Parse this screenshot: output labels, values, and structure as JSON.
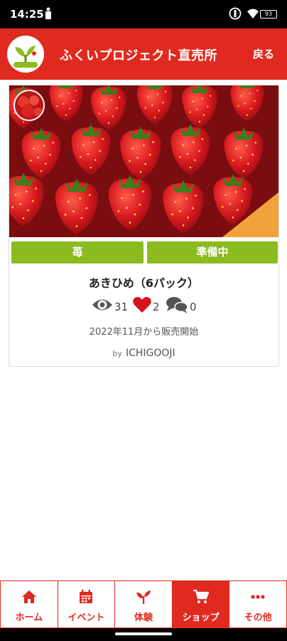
{
  "status_bar": {
    "time": "14:25",
    "battery": "93",
    "icons": [
      "silent-icon",
      "wifi-icon",
      "battery-icon"
    ]
  },
  "header": {
    "title": "ふくいプロジェクト直売所",
    "back_label": "戻る",
    "logo_icon": "sprout-logo-icon"
  },
  "product": {
    "category": "苺",
    "status": "準備中",
    "name": "あきひめ（6パック）",
    "views": "31",
    "likes": "2",
    "comments": "0",
    "release": "2022年11月から販売開始",
    "by_label": "by",
    "author": "ICHIGOOJI"
  },
  "nav": {
    "items": [
      {
        "label": "ホーム",
        "icon": "home-icon"
      },
      {
        "label": "イベント",
        "icon": "calendar-icon"
      },
      {
        "label": "体験",
        "icon": "sprout-icon"
      },
      {
        "label": "ショップ",
        "icon": "cart-icon",
        "active": true
      },
      {
        "label": "その他",
        "icon": "more-icon"
      }
    ]
  },
  "colors": {
    "brand_red": "#e02a1f",
    "tag_green": "#8cbb21",
    "heart_red": "#d9141c",
    "icon_gray": "#555555"
  }
}
